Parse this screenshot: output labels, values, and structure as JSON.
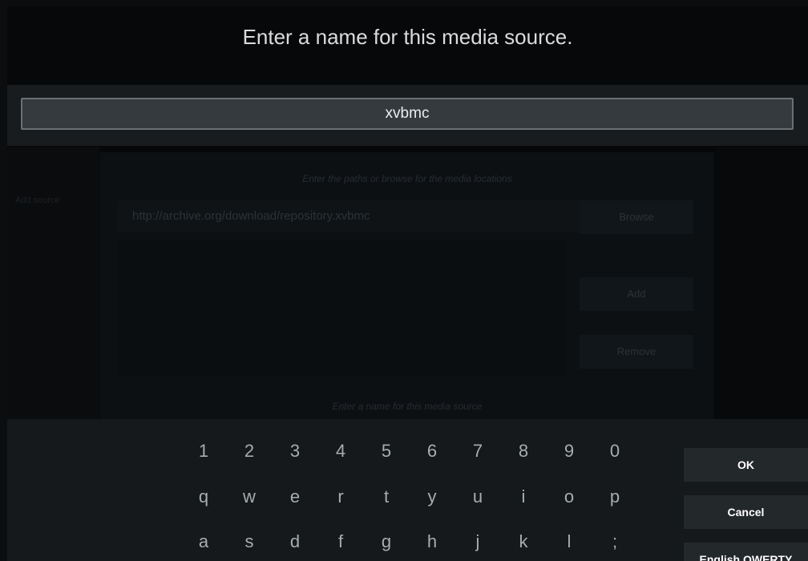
{
  "dialog": {
    "title": "Enter a name for this media source.",
    "input_value": "xvbmc"
  },
  "background_dialog": {
    "hint_text": "Enter the paths or browse for the media locations",
    "path_value": "http://archive.org/download/repository.xvbmc",
    "browse_label": "Browse",
    "add_label": "Add",
    "remove_label": "Remove",
    "name_hint": "Enter a name for this media source",
    "side_label": "Add source"
  },
  "keyboard": {
    "digits": [
      "1",
      "2",
      "3",
      "4",
      "5",
      "6",
      "7",
      "8",
      "9",
      "0"
    ],
    "row_qwerty": [
      "q",
      "w",
      "e",
      "r",
      "t",
      "y",
      "u",
      "i",
      "o",
      "p"
    ],
    "row_asdf": [
      "a",
      "s",
      "d",
      "f",
      "g",
      "h",
      "j",
      "k",
      "l",
      ";"
    ],
    "ok_label": "OK",
    "cancel_label": "Cancel",
    "layout_label": "English QWERTY"
  }
}
